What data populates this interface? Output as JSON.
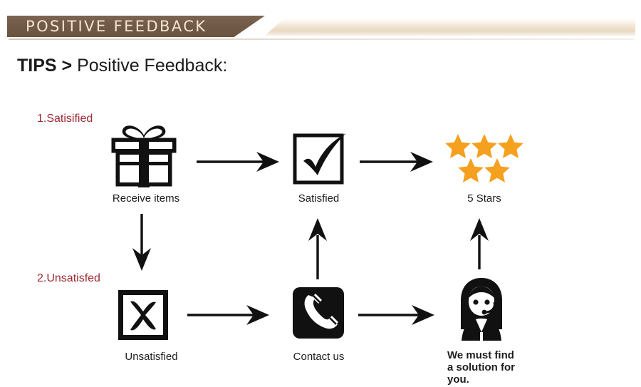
{
  "banner": {
    "title": "POSITIVE  FEEDBACK",
    "brown_color": "#6f5845",
    "text_color": "#f4e4cf",
    "cream_color": "#ead8c0"
  },
  "heading": {
    "strong": "TIPS >",
    "regular": " Positive Feedback:"
  },
  "colors": {
    "label_red": "#9d2b33",
    "star_orange": "#f5a01e",
    "ink_black": "#111111",
    "background": "#ffffff"
  },
  "rows": [
    {
      "label": "1.Satisified"
    },
    {
      "label": "2.Unsatisfed"
    }
  ],
  "flow": {
    "satisfied_path": [
      {
        "icon": "gift-box-icon",
        "caption": "Receive items"
      },
      {
        "icon": "checkmark-box-icon",
        "caption": "Satisfied"
      },
      {
        "icon": "five-stars-icon",
        "caption": "5 Stars"
      }
    ],
    "unsatisfied_path": [
      {
        "icon": "x-mark-box-icon",
        "caption": "Unsatisfied"
      },
      {
        "icon": "telephone-icon",
        "caption": "Contact us"
      },
      {
        "icon": "support-agent-icon",
        "caption": "We must find\na solution for\nyou."
      }
    ]
  },
  "captions": {
    "receive_items": "Receive items",
    "satisfied": "Satisfied",
    "five_stars": "5 Stars",
    "unsatisfied": "Unsatisfied",
    "contact_us": "Contact us",
    "resolution_line1": "We must find",
    "resolution_line2": "a solution for",
    "resolution_line3": "you."
  },
  "stars": {
    "count": 5,
    "top_row": 3,
    "bottom_row": 2
  },
  "arrows": [
    {
      "name": "arrow-receive-to-satisfied",
      "direction": "right"
    },
    {
      "name": "arrow-satisfied-to-stars",
      "direction": "right"
    },
    {
      "name": "arrow-receive-to-unsatisfied",
      "direction": "down"
    },
    {
      "name": "arrow-unsatisfied-to-contact",
      "direction": "right"
    },
    {
      "name": "arrow-contact-to-agent",
      "direction": "right"
    },
    {
      "name": "arrow-contact-to-satisfied",
      "direction": "up"
    },
    {
      "name": "arrow-agent-to-stars",
      "direction": "up"
    }
  ]
}
